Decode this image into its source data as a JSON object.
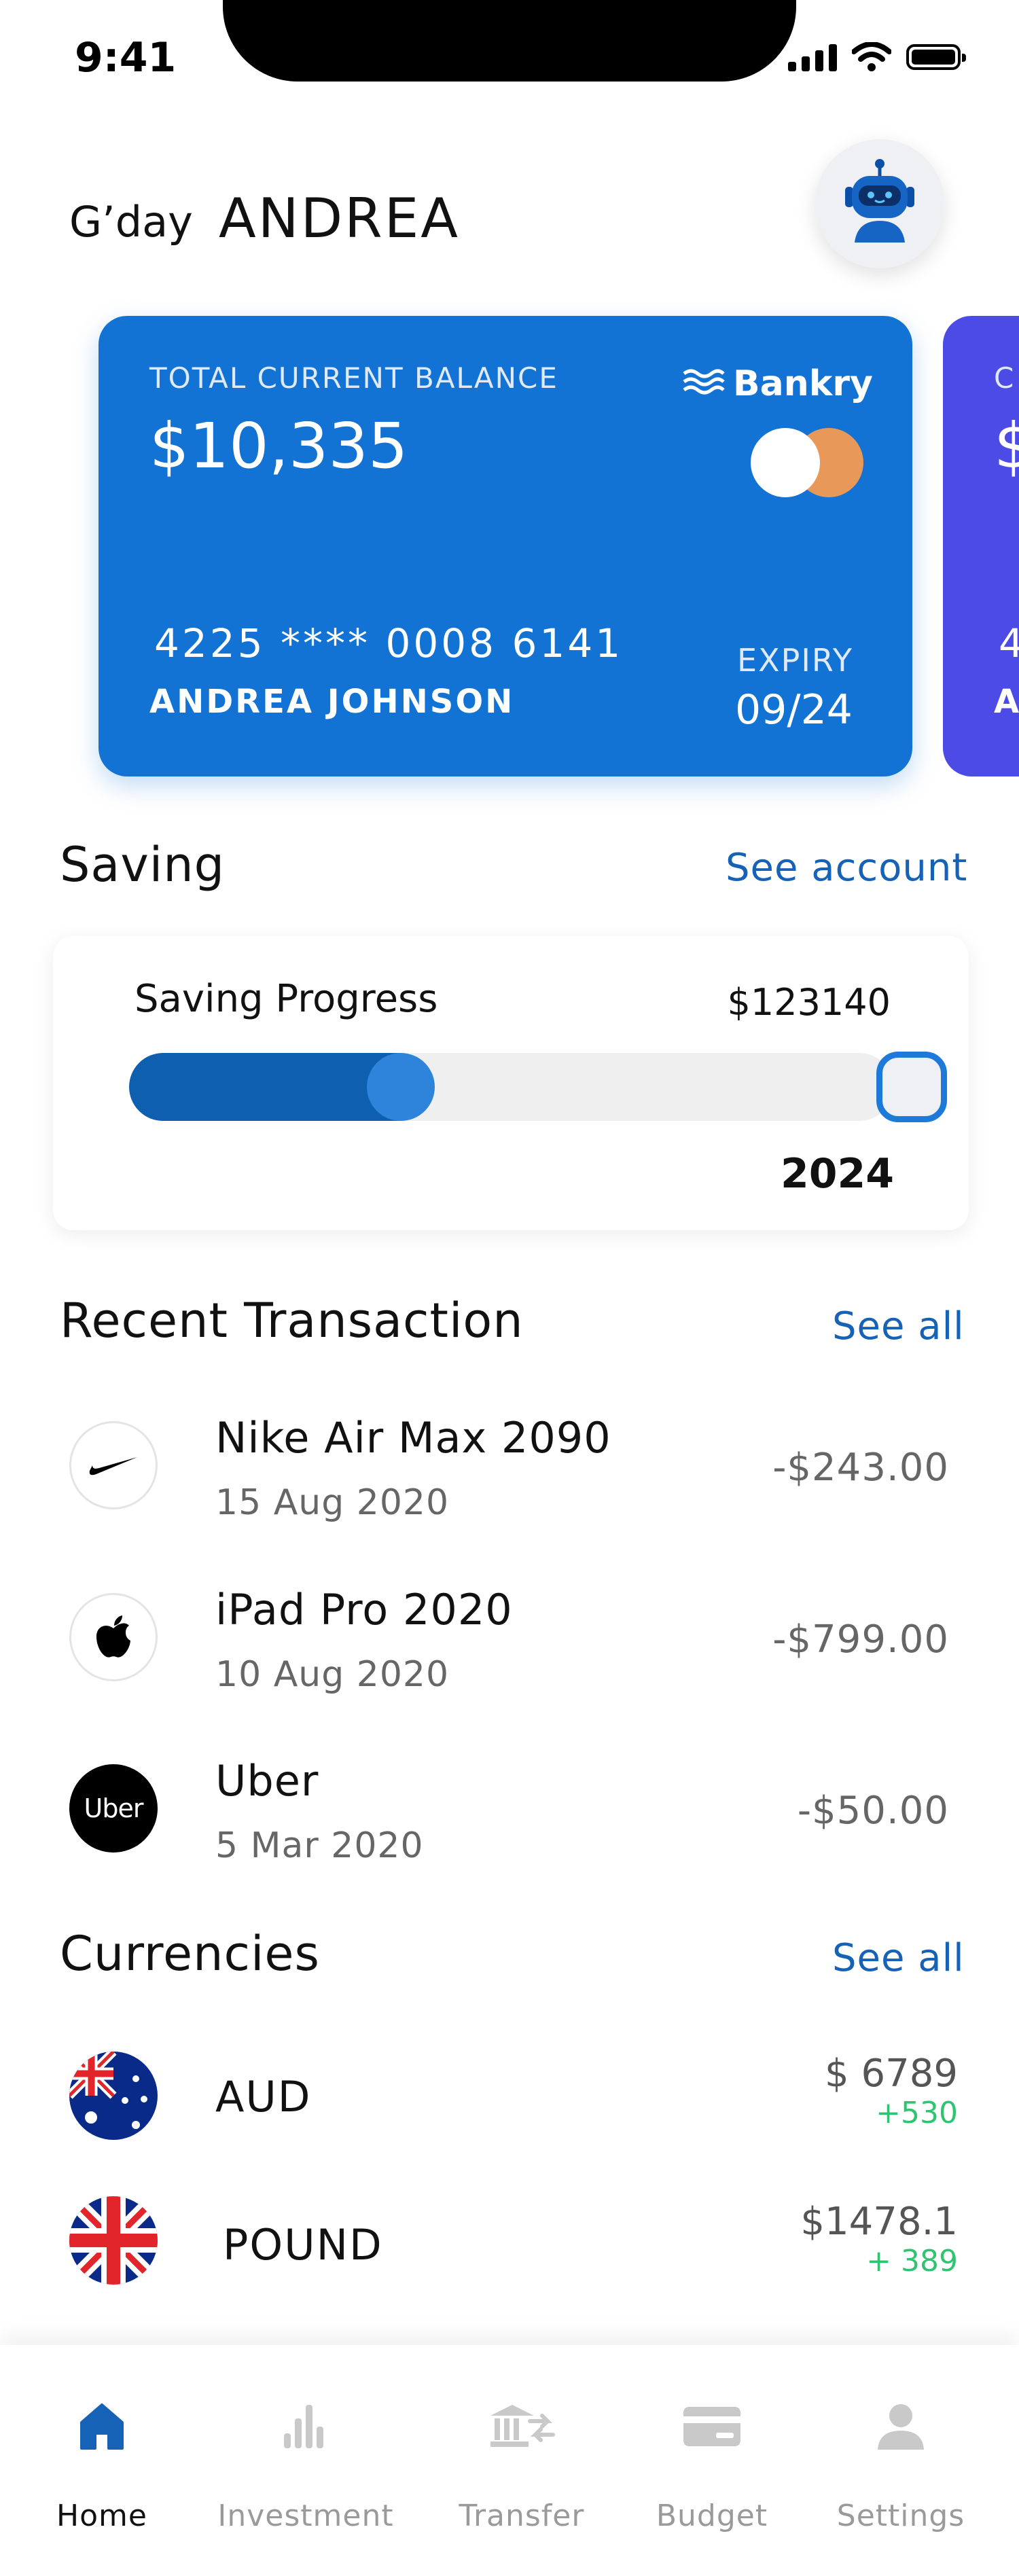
{
  "status_bar": {
    "time": "9:41"
  },
  "header": {
    "greeting": "G’day",
    "name": "ANDREA"
  },
  "cards": [
    {
      "label": "TOTAL CURRENT BALANCE",
      "balance": "$10,335",
      "bank": "Bankry",
      "number": "4225 **** 0008 6141",
      "holder": "ANDREA JOHNSON",
      "expiry_label": "EXPIRY",
      "expiry": "09/24",
      "color": "#1273d4"
    },
    {
      "label_partial": "C",
      "balance_partial": "$",
      "number_partial": "4",
      "holder_partial": "A",
      "color": "#4c4be6"
    }
  ],
  "saving": {
    "title": "Saving",
    "link": "See account",
    "progress_label": "Saving Progress",
    "amount": "$123140",
    "year": "2024",
    "progress_fraction": 0.4
  },
  "transactions": {
    "title": "Recent Transaction",
    "link": "See all",
    "items": [
      {
        "name": "Nike Air Max 2090",
        "date": "15 Aug 2020",
        "amount": "-$243.00",
        "icon": "nike-logo-icon"
      },
      {
        "name": "iPad Pro 2020",
        "date": "10 Aug 2020",
        "amount": "-$799.00",
        "icon": "apple-logo-icon"
      },
      {
        "name": "Uber",
        "date": "5 Mar 2020",
        "amount": "-$50.00",
        "icon": "uber-logo-icon",
        "logo_text": "Uber"
      }
    ]
  },
  "currencies": {
    "title": "Currencies",
    "link": "See all",
    "items": [
      {
        "name": "AUD",
        "value": "$ 6789",
        "change": "+530",
        "flag": "australia-flag-icon"
      },
      {
        "name": "POUND",
        "value": "$1478.1",
        "change": "+ 389",
        "flag": "uk-flag-icon"
      }
    ]
  },
  "tabbar": {
    "items": [
      {
        "label": "Home",
        "icon": "home-icon",
        "active": true
      },
      {
        "label": "Investment",
        "icon": "bar-chart-icon",
        "active": false
      },
      {
        "label": "Transfer",
        "icon": "bank-transfer-icon",
        "active": false
      },
      {
        "label": "Budget",
        "icon": "credit-card-icon",
        "active": false
      },
      {
        "label": "Settings",
        "icon": "user-icon",
        "active": false
      }
    ]
  },
  "colors": {
    "primary": "#1662b6",
    "card_blue": "#1273d4",
    "card_purple": "#4c4be6",
    "positive": "#2fc46f",
    "inactive": "#c9c9c9"
  }
}
